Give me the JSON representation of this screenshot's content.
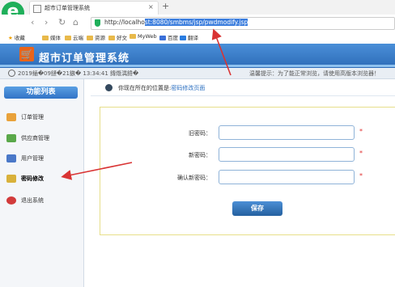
{
  "browser": {
    "tab_title": "超市订单管理系统",
    "tab_close": "×",
    "new_tab": "+",
    "nav_back": "‹",
    "nav_forward": "›",
    "nav_refresh": "↻",
    "nav_home": "⌂",
    "url_prefix": "http://localho",
    "url_selected": "st:8080/smbms/jsp/pwdmodify.jsp",
    "bookmarks": [
      "收藏",
      "媒体",
      "云端",
      "资源",
      "好文",
      "MyWeb",
      "百度",
      "翻译"
    ]
  },
  "app": {
    "title": "超市订单管理系统",
    "datetime": "2019鍤�09鏈�21鏃� 13:34:41 鏄熸湡鍏�",
    "notice": "温馨提示：为了能正常浏览，请使用高版本浏览器！"
  },
  "sidebar": {
    "title": "功能列表",
    "items": [
      {
        "label": "订单管理",
        "icon": "order-icon",
        "color": "#e9a23b"
      },
      {
        "label": "供应商管理",
        "icon": "provider-icon",
        "color": "#5aa84a"
      },
      {
        "label": "用户管理",
        "icon": "user-icon",
        "color": "#4a78c8"
      },
      {
        "label": "密码修改",
        "icon": "password-icon",
        "color": "#d9b13a"
      },
      {
        "label": "退出系统",
        "icon": "exit-icon",
        "color": "#d23b3b"
      }
    ]
  },
  "main": {
    "location_prefix": "你现在所在的位置是:",
    "location_current": "密码修改页面",
    "form": {
      "old_label": "旧密码：",
      "new_label": "新密码：",
      "confirm_label": "确认新密码：",
      "old_value": "",
      "new_value": "",
      "confirm_value": "",
      "required_mark": "*",
      "save_label": "保存"
    }
  },
  "colors": {
    "header_blue": "#2d6cb8",
    "accent_blue": "#3b7ddd",
    "annotation_red": "#d93434",
    "panel_border": "#e7df8a"
  }
}
